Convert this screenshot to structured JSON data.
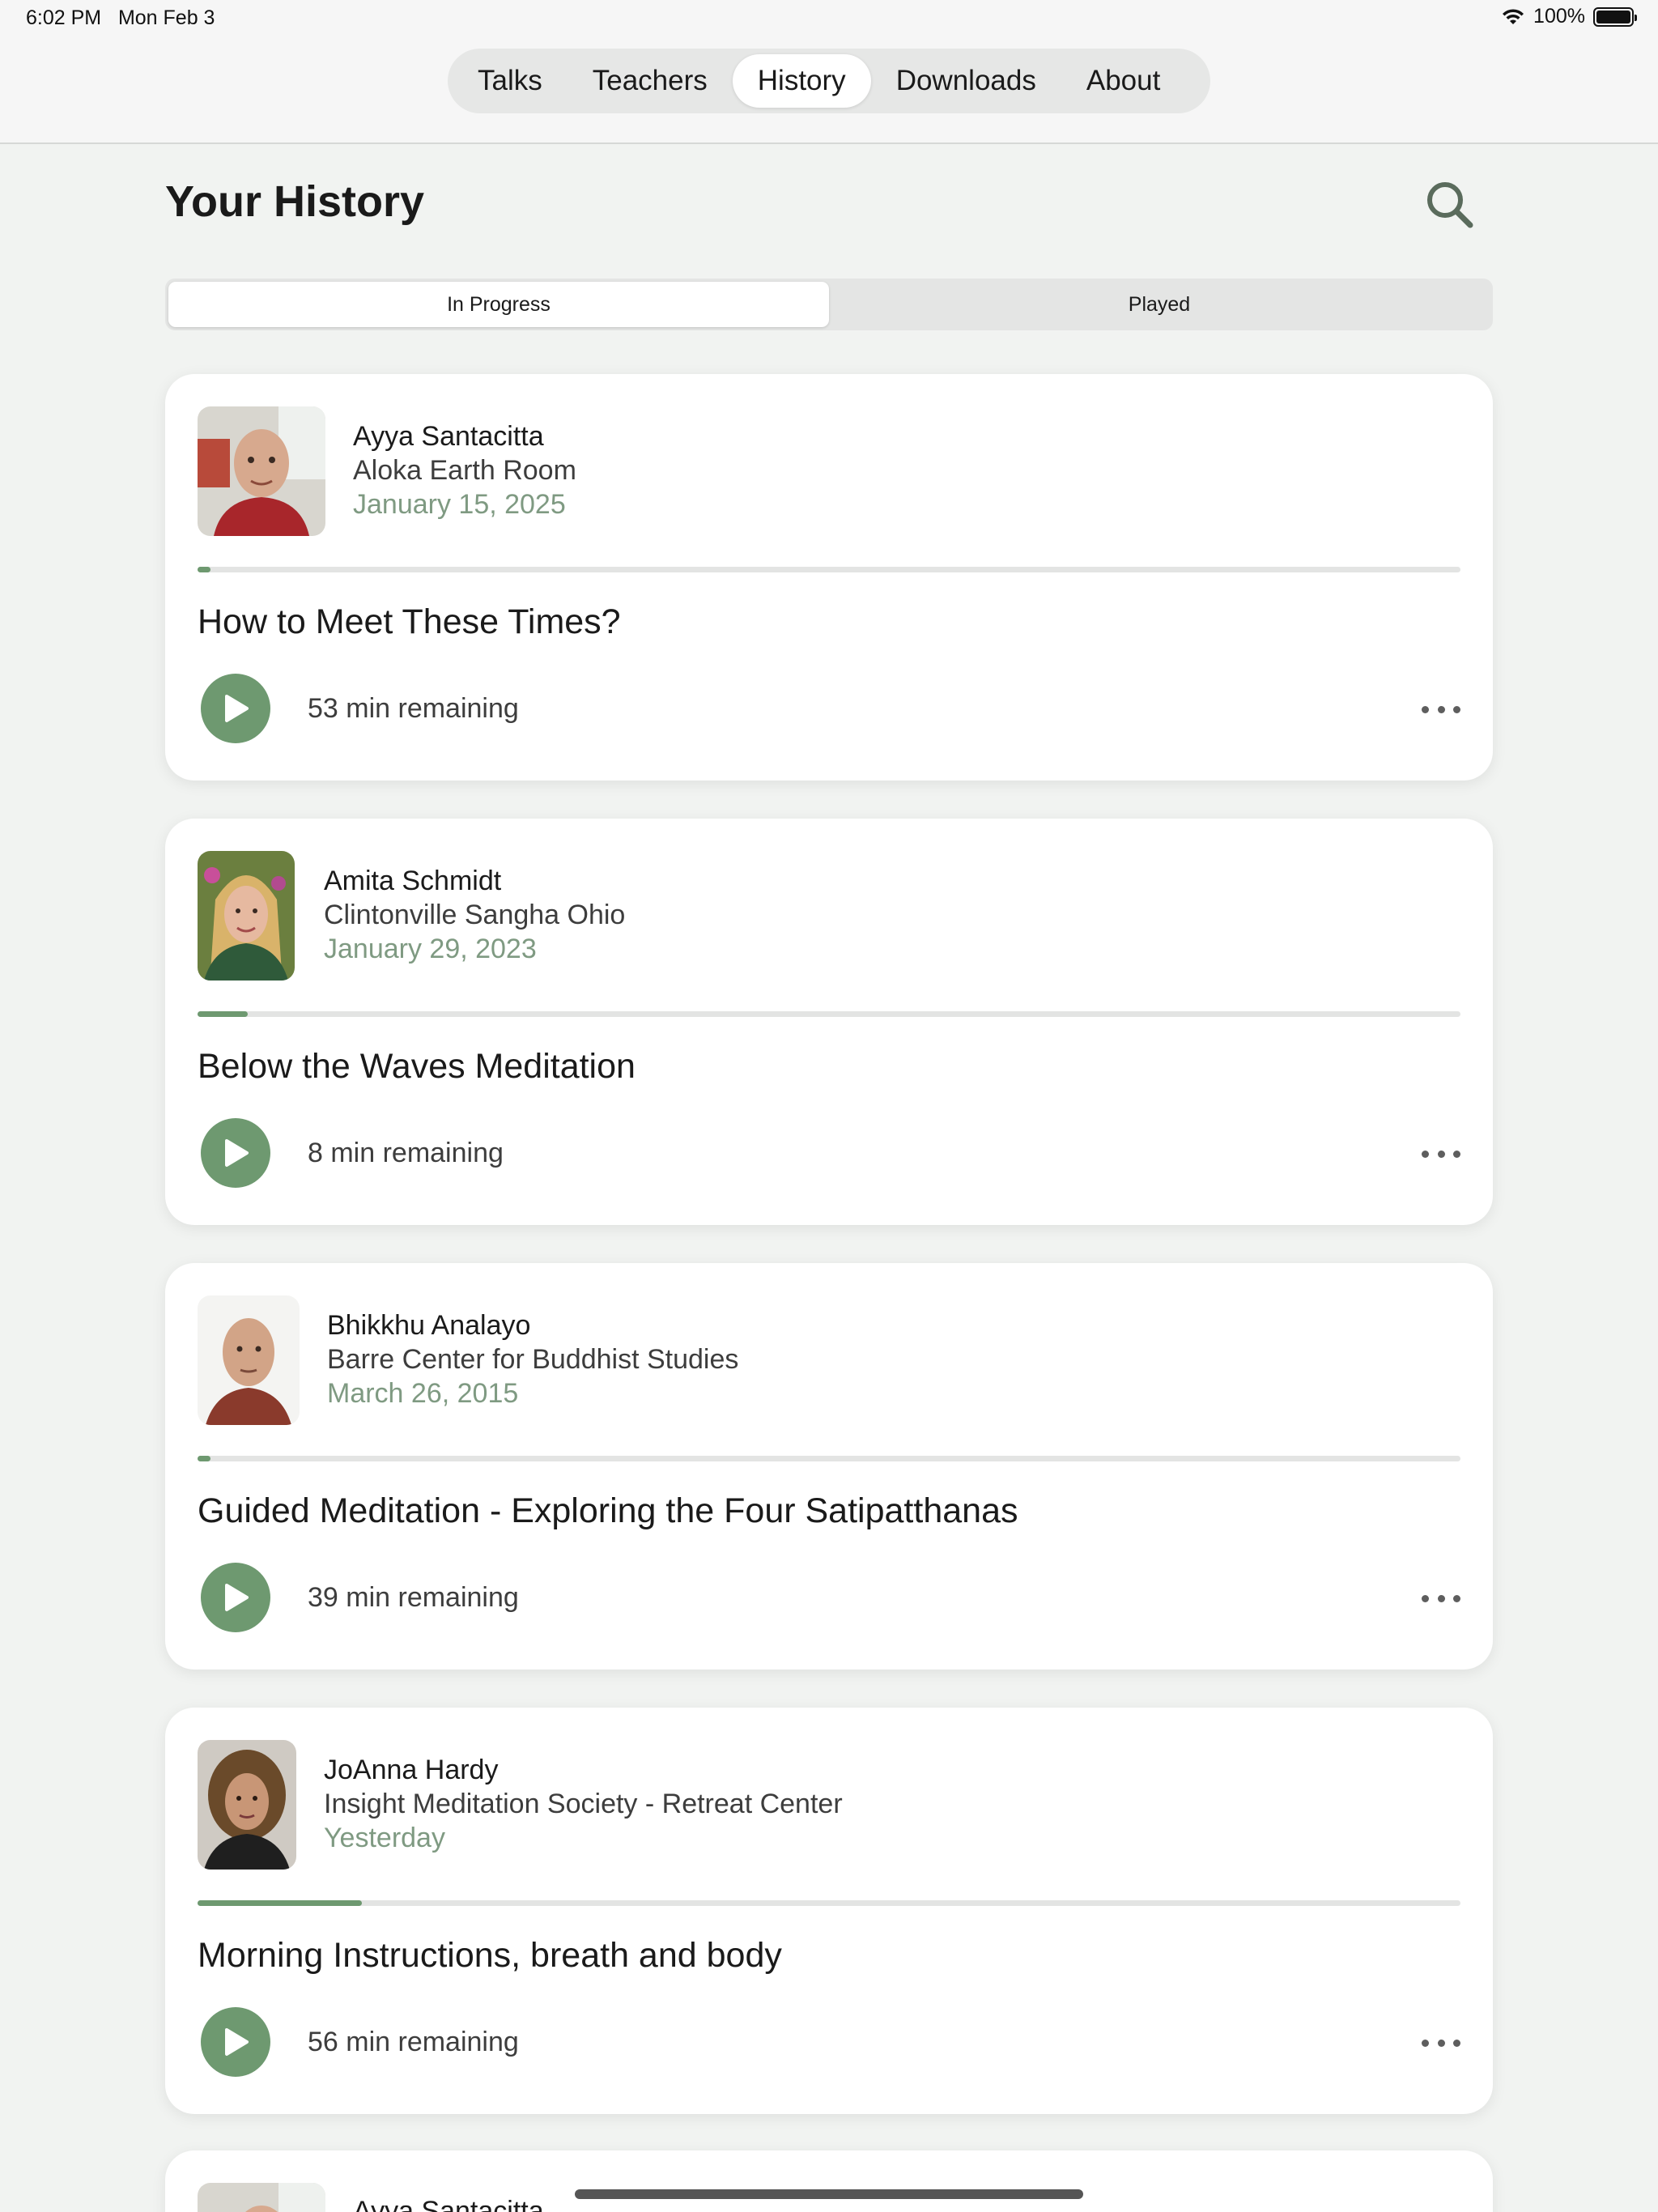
{
  "status": {
    "time": "6:02 PM",
    "date": "Mon Feb 3",
    "battery": "100%"
  },
  "nav": {
    "tabs": [
      "Talks",
      "Teachers",
      "History",
      "Downloads",
      "About"
    ],
    "active_index": 2
  },
  "header": {
    "title": "Your History"
  },
  "filter": {
    "tabs": [
      "In Progress",
      "Played"
    ],
    "active_index": 0
  },
  "cards": [
    {
      "teacher": "Ayya Santacitta",
      "venue": "Aloka Earth Room",
      "date": "January 15, 2025",
      "title": "How to Meet These Times?",
      "remaining": "53 min remaining",
      "progress": 0.01
    },
    {
      "teacher": "Amita Schmidt",
      "venue": "Clintonville Sangha Ohio",
      "date": "January 29, 2023",
      "title": "Below the Waves Meditation",
      "remaining": "8 min remaining",
      "progress": 0.04
    },
    {
      "teacher": "Bhikkhu Analayo",
      "venue": "Barre Center for Buddhist Studies",
      "date": "March 26, 2015",
      "title": "Guided Meditation - Exploring the Four Satipatthanas",
      "remaining": "39 min remaining",
      "progress": 0.01
    },
    {
      "teacher": "JoAnna Hardy",
      "venue": "Insight Meditation Society - Retreat Center",
      "date": "Yesterday",
      "title": "Morning Instructions, breath and body",
      "remaining": "56 min remaining",
      "progress": 0.13
    }
  ],
  "partial_card": {
    "teacher": "Ayya Santacitta"
  },
  "colors": {
    "accent": "#6e9970",
    "background": "#f1f3f1",
    "date_text": "#7f9a82"
  }
}
